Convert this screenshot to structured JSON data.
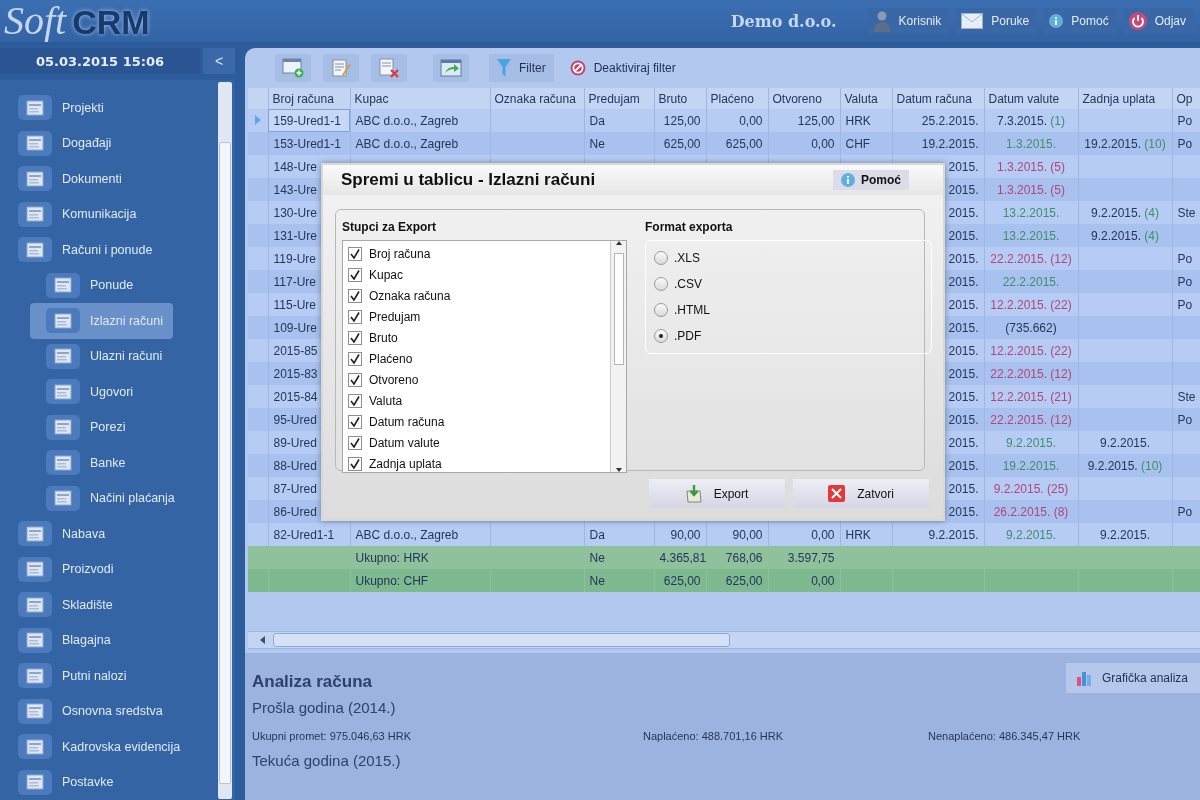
{
  "header": {
    "logo_script": "Soft",
    "logo_bold": "CRM",
    "company": "Demo d.o.o.",
    "actions": [
      {
        "kind": "user",
        "label": "Korisnik"
      },
      {
        "kind": "messages",
        "label": "Poruke"
      },
      {
        "kind": "help",
        "label": "Pomoć"
      },
      {
        "kind": "logout",
        "label": "Odjav"
      }
    ]
  },
  "sidebar": {
    "datetime": "05.03.2015 15:06",
    "collapse": "<",
    "items": [
      {
        "label": "Projekti",
        "selected": false
      },
      {
        "label": "Događaji",
        "selected": false
      },
      {
        "label": "Dokumenti",
        "selected": false
      },
      {
        "label": "Komunikacija",
        "selected": false
      },
      {
        "label": "Računi i ponude",
        "selected": false,
        "children": [
          {
            "label": "Ponude",
            "selected": false
          },
          {
            "label": "Izlazni računi",
            "selected": true
          },
          {
            "label": "Ulazni računi",
            "selected": false
          },
          {
            "label": "Ugovori",
            "selected": false
          },
          {
            "label": "Porezi",
            "selected": false
          },
          {
            "label": "Banke",
            "selected": false
          },
          {
            "label": "Načini plaćanja",
            "selected": false
          }
        ]
      },
      {
        "label": "Nabava",
        "selected": false
      },
      {
        "label": "Proizvodi",
        "selected": false
      },
      {
        "label": "Skladište",
        "selected": false
      },
      {
        "label": "Blagajna",
        "selected": false
      },
      {
        "label": "Putni nalozi",
        "selected": false
      },
      {
        "label": "Osnovna sredstva",
        "selected": false
      },
      {
        "label": "Kadrovska evidencija",
        "selected": false
      },
      {
        "label": "Postavke",
        "selected": false
      }
    ]
  },
  "toolbar": {
    "filter": "Filter",
    "clear_filter": "Deaktiviraj filter"
  },
  "table": {
    "columns": [
      "Broj računa",
      "Kupac",
      "Oznaka računa",
      "Predujam",
      "Bruto",
      "Plaćeno",
      "Otvoreno",
      "Valuta",
      "Datum računa",
      "Datum valute",
      "Zadnja uplata",
      "Op"
    ],
    "rows": [
      {
        "kind": "invoice",
        "selected": true,
        "broj": "159-Ured1-1",
        "kupac": "ABC d.o.o., Zagreb",
        "predujam": "Da",
        "bruto": "125,00",
        "placeno": "0,00",
        "otvoreno": "125,00",
        "valuta": "HRK",
        "datum_racuna": "25.2.2015.",
        "datum_valute": {
          "date": "7.3.2015.",
          "days": "(1)",
          "kind": "open"
        },
        "column_12": "Po"
      },
      {
        "kind": "invoice",
        "selected": false,
        "broj": "153-Ured1-1",
        "kupac": "ABC d.o.o., Zagreb",
        "predujam": "Ne",
        "bruto": "625,00",
        "placeno": "625,00",
        "otvoreno": "0,00",
        "valuta": "CHF",
        "datum_racuna": "19.2.2015.",
        "datum_valute": {
          "date": "1.3.2015.",
          "kind": "paid"
        },
        "zadnja_uplata": {
          "date": "19.2.2015.",
          "days": "(10)"
        },
        "column_12": "Po"
      },
      {
        "kind": "invoice",
        "selected": false,
        "broj": "148-Ure",
        "datum_racuna": "2015.",
        "datum_valute": {
          "date": "1.3.2015.",
          "days": "(5)",
          "kind": "late"
        }
      },
      {
        "kind": "invoice",
        "selected": false,
        "broj": "143-Ure",
        "datum_racuna": "2015.",
        "datum_valute": {
          "date": "1.3.2015.",
          "days": "(5)",
          "kind": "late"
        }
      },
      {
        "kind": "invoice",
        "selected": false,
        "broj": "130-Ure",
        "datum_racuna": "2015.",
        "datum_valute": {
          "date": "13.2.2015.",
          "kind": "paid"
        },
        "zadnja_uplata": {
          "date": "9.2.2015.",
          "days": "(4)"
        },
        "column_12": "Ste"
      },
      {
        "kind": "invoice",
        "selected": false,
        "broj": "131-Ure",
        "datum_racuna": "2015.",
        "datum_valute": {
          "date": "13.2.2015.",
          "kind": "paid"
        },
        "zadnja_uplata": {
          "date": "9.2.2015.",
          "days": "(4)"
        }
      },
      {
        "kind": "invoice",
        "selected": false,
        "broj": "119-Ure",
        "datum_racuna": "2015.",
        "datum_valute": {
          "date": "22.2.2015.",
          "days": "(12)",
          "kind": "late"
        },
        "column_12": "Po"
      },
      {
        "kind": "invoice",
        "selected": false,
        "broj": "117-Ure",
        "datum_racuna": "2015.",
        "datum_valute": {
          "date": "22.2.2015.",
          "kind": "paid"
        },
        "column_12": "Po"
      },
      {
        "kind": "invoice",
        "selected": false,
        "broj": "115-Ure",
        "datum_racuna": "2015.",
        "datum_valute": {
          "date": "12.2.2015.",
          "days": "(22)",
          "kind": "late"
        },
        "column_12": "Po"
      },
      {
        "kind": "invoice",
        "selected": false,
        "broj": "109-Ure",
        "datum_racuna": "2015.",
        "datum_valute": {
          "date": "(735.662)",
          "kind": "open"
        }
      },
      {
        "kind": "invoice",
        "selected": false,
        "broj": "2015-85",
        "datum_racuna": "2015.",
        "datum_valute": {
          "date": "12.2.2015.",
          "days": "(22)",
          "kind": "late"
        }
      },
      {
        "kind": "invoice",
        "selected": false,
        "broj": "2015-83",
        "datum_racuna": "2015.",
        "datum_valute": {
          "date": "22.2.2015.",
          "days": "(12)",
          "kind": "late"
        }
      },
      {
        "kind": "invoice",
        "selected": false,
        "broj": "2015-84",
        "datum_racuna": "2015.",
        "datum_valute": {
          "date": "12.2.2015.",
          "days": "(21)",
          "kind": "late"
        },
        "column_12": "Ste"
      },
      {
        "kind": "invoice",
        "selected": false,
        "broj": "95-Ured",
        "datum_racuna": "2015.",
        "datum_valute": {
          "date": "22.2.2015.",
          "days": "(12)",
          "kind": "late"
        },
        "column_12": "Po"
      },
      {
        "kind": "invoice",
        "selected": false,
        "broj": "89-Ured",
        "datum_racuna": "2015.",
        "datum_valute": {
          "date": "9.2.2015.",
          "kind": "paid"
        },
        "zadnja_uplata": {
          "date": "9.2.2015."
        }
      },
      {
        "kind": "invoice",
        "selected": false,
        "broj": "88-Ured",
        "datum_racuna": "2015.",
        "datum_valute": {
          "date": "19.2.2015.",
          "kind": "paid"
        },
        "zadnja_uplata": {
          "date": "9.2.2015.",
          "days": "(10)"
        }
      },
      {
        "kind": "invoice",
        "selected": false,
        "broj": "87-Ured",
        "datum_racuna": "2015.",
        "datum_valute": {
          "date": "9.2.2015.",
          "days": "(25)",
          "kind": "late"
        }
      },
      {
        "kind": "invoice",
        "selected": false,
        "broj": "86-Ured",
        "datum_racuna": "2015.",
        "datum_valute": {
          "date": "26.2.2015.",
          "days": "(8)",
          "kind": "late"
        },
        "column_12": "Po"
      },
      {
        "kind": "invoice",
        "selected": false,
        "broj": "82-Ured1-1",
        "kupac": "ABC d.o.o., Zagreb",
        "predujam": "Da",
        "bruto": "90,00",
        "placeno": "90,00",
        "otvoreno": "0,00",
        "valuta": "HRK",
        "datum_racuna": "9.2.2015.",
        "datum_valute": {
          "date": "9.2.2015.",
          "kind": "paid"
        },
        "zadnja_uplata": {
          "date": "9.2.2015."
        }
      },
      {
        "kind": "total",
        "selected": false,
        "kupac": "Ukupno: HRK",
        "predujam": "Ne",
        "bruto": "4.365,81",
        "placeno": "768,06",
        "otvoreno": "3.597,75"
      },
      {
        "kind": "total",
        "selected": false,
        "kupac": "Ukupno: CHF",
        "predujam": "Ne",
        "bruto": "625,00",
        "placeno": "625,00",
        "otvoreno": "0,00"
      }
    ]
  },
  "dialog": {
    "title": "Spremi u tablicu - Izlazni računi",
    "help": "Pomoć",
    "columns_title": "Stupci za Export",
    "columns": [
      {
        "label": "Broj računa",
        "checked": true
      },
      {
        "label": "Kupac",
        "checked": true
      },
      {
        "label": "Oznaka računa",
        "checked": true
      },
      {
        "label": "Predujam",
        "checked": true
      },
      {
        "label": "Bruto",
        "checked": true
      },
      {
        "label": "Plaćeno",
        "checked": true
      },
      {
        "label": "Otvoreno",
        "checked": true
      },
      {
        "label": "Valuta",
        "checked": true
      },
      {
        "label": "Datum računa",
        "checked": true
      },
      {
        "label": "Datum valute",
        "checked": true
      },
      {
        "label": "Zadnja uplata",
        "checked": true
      }
    ],
    "format_title": "Format exporta",
    "formats": [
      {
        "label": ".XLS",
        "selected": false
      },
      {
        "label": ".CSV",
        "selected": false
      },
      {
        "label": ".HTML",
        "selected": false
      },
      {
        "label": ".PDF",
        "selected": true
      }
    ],
    "export": "Export",
    "close": "Zatvori"
  },
  "analysis": {
    "title": "Analiza računa",
    "chart_button": "Grafička analiza",
    "previous_year": "Prošla godina (2014.)",
    "stats": [
      "Ukupni promet: 975.046,63 HRK",
      "Naplaćeno: 488.701,16 HRK",
      "Nenaplaćeno: 486.345,47 HRK"
    ],
    "current_year": "Tekuća godina (2015.)"
  }
}
